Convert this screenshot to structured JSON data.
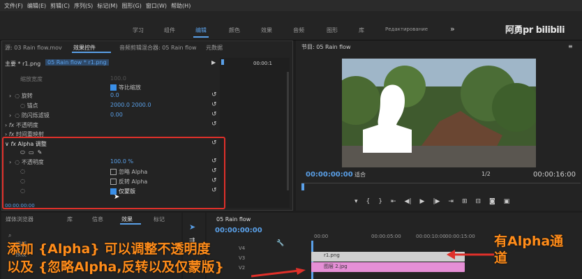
{
  "menu": [
    "文件(F)",
    "编辑(E)",
    "剪辑(C)",
    "序列(S)",
    "标记(M)",
    "图形(G)",
    "窗口(W)",
    "帮助(H)"
  ],
  "workspaces": [
    "学习",
    "组件",
    "编辑",
    "颜色",
    "效果",
    "音频",
    "图形",
    "库",
    "Редактирование"
  ],
  "workspace_active": "编辑",
  "watermark": "阿勇pr bilibili",
  "effect_panel": {
    "tabs": [
      "源: 03 Rain flow.mov",
      "效果控件",
      "音频剪辑混合器: 05 Rain flow",
      "元数据"
    ],
    "clip_master": "主要 * r1.png",
    "clip_seq": "05 Rain flow * r1.png",
    "clip_time": "00:00:1",
    "rows": [
      {
        "label": "缩放宽度",
        "value": "100.0"
      },
      {
        "label": "等比缩放",
        "value": ""
      },
      {
        "label": "旋转",
        "value": "0.0"
      },
      {
        "label": "锚点",
        "value": "2000.0   2000.0"
      },
      {
        "label": "防闪烁滤镜",
        "value": "0.00"
      },
      {
        "label": "不透明度",
        "value": ""
      },
      {
        "label": "时间重映射",
        "value": ""
      },
      {
        "label": "Alpha 调整",
        "value": ""
      },
      {
        "label": "不透明度",
        "value": "100.0 %"
      },
      {
        "label": "忽略 Alpha",
        "value": ""
      },
      {
        "label": "反转 Alpha",
        "value": ""
      },
      {
        "label": "仅蒙版",
        "value": ""
      }
    ],
    "bottom_time": "00:00:00:00"
  },
  "program": {
    "tab": "节目: 05 Rain flow",
    "timecode": "00:00:00:00",
    "fit": "适合",
    "ratio": "1/2",
    "duration": "00:00:16:00"
  },
  "project": {
    "tabs": [
      "媒体浏览器",
      "库",
      "信息",
      "效果",
      "标记"
    ],
    "items": [
      "视频",
      "预设"
    ]
  },
  "timeline": {
    "tab": "05 Rain flow",
    "timecode": "00:00:00:00",
    "ruler": [
      "00:00",
      "00:00:05:00",
      "00:00:10:00",
      "00:00:15:00"
    ],
    "tracks": [
      "V4",
      "V3",
      "V2"
    ],
    "clip1": "r1.png",
    "clip2": "图层 2.jpg"
  },
  "callouts": {
    "left_line1": "添加 {Alpha} 可以调整不透明度",
    "left_line2": "以及 {忽略Alpha,反转以及仅蒙版}",
    "right": "有Alpha通道"
  },
  "colors": {
    "accent": "#5aa0e8",
    "highlight": "#e0302a",
    "callout": "#ff8c1a",
    "clip_pink": "#e58fd6"
  }
}
